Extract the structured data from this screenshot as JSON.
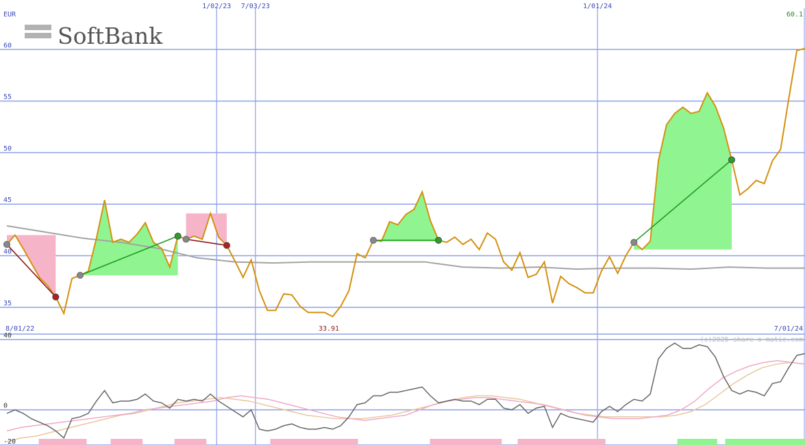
{
  "currency": "EUR",
  "last_price_label": "60.1",
  "copyright": "(c)2025 share-o-matic.com",
  "lowest_label": "33.91",
  "logo": {
    "text": "SoftBank",
    "icon": "softbank-bars-logo"
  },
  "colors": {
    "price": "#d4900f",
    "ma": "#a3a3a3",
    "grid": "#8da0e8",
    "axis_text": "#3a49b8",
    "up_fill": "#90f590",
    "down_fill": "#f5b4c8",
    "up_line": "#1f9a1f",
    "down_line": "#8b1a1a",
    "osc": "#666666",
    "osc_pink": "#f0a8c8",
    "osc_tan": "#e8c89a"
  },
  "chart_data": [
    {
      "type": "line",
      "y_unit": "EUR",
      "ylim": [
        32.4,
        64.8
      ],
      "y_ticks": [
        35,
        40,
        45,
        50,
        55,
        60
      ],
      "x_range": [
        "2022-08-01",
        "2024-07-01"
      ],
      "x_tick_labels": [
        {
          "date": "2022-08-01",
          "label": "8/01/22",
          "where": "bottom"
        },
        {
          "date": "2023-02-01",
          "label": "1/02/23",
          "where": "top"
        },
        {
          "date": "2023-03-07",
          "label": "7/03/23",
          "where": "top"
        },
        {
          "date": "2024-01-01",
          "label": "1/01/24",
          "where": "top"
        },
        {
          "date": "2024-07-01",
          "label": "7/01/24",
          "where": "bottom"
        }
      ],
      "grid": true,
      "series": [
        {
          "key": "price",
          "values": [
            41.1,
            42.0,
            40.7,
            39.3,
            37.9,
            37.1,
            36.0,
            34.4,
            37.8,
            38.1,
            38.5,
            41.7,
            45.4,
            41.3,
            41.6,
            41.3,
            42.1,
            43.2,
            41.3,
            40.7,
            38.9,
            41.9,
            41.6,
            41.9,
            41.6,
            44.1,
            41.8,
            41.0,
            39.5,
            37.9,
            39.6,
            36.6,
            34.7,
            34.7,
            36.3,
            36.2,
            35.1,
            34.5,
            34.5,
            34.5,
            34.1,
            35.1,
            36.6,
            40.2,
            39.8,
            41.5,
            41.4,
            43.3,
            43.0,
            44.0,
            44.5,
            46.2,
            43.4,
            41.5,
            41.3,
            41.8,
            41.1,
            41.6,
            40.6,
            42.2,
            41.6,
            39.4,
            38.6,
            40.3,
            37.9,
            38.2,
            39.4,
            35.4,
            38.0,
            37.3,
            36.9,
            36.4,
            36.4,
            38.5,
            39.9,
            38.3,
            40.0,
            41.3,
            40.6,
            41.4,
            49.2,
            52.7,
            53.8,
            54.4,
            53.8,
            54.0,
            55.8,
            54.5,
            52.4,
            49.3,
            45.9,
            46.5,
            47.3,
            47.0,
            49.2,
            50.3,
            55.2,
            59.9,
            60.1
          ]
        },
        {
          "key": "ma",
          "values": [
            42.9,
            42.3,
            41.7,
            41.3,
            40.7,
            39.8,
            39.4,
            39.3,
            39.4,
            39.4,
            39.4,
            39.4,
            38.9,
            38.8,
            38.9,
            38.7,
            38.8,
            38.8,
            38.7,
            38.9,
            38.8,
            38.8
          ]
        }
      ],
      "swings": [
        {
          "type": "down",
          "from_index": 0,
          "to_index": 6
        },
        {
          "type": "up",
          "from_index": 9,
          "to_index": 21
        },
        {
          "type": "down",
          "from_index": 22,
          "to_index": 27
        },
        {
          "type": "up",
          "from_index": 45,
          "to_index": 53
        },
        {
          "type": "up",
          "from_index": 77,
          "to_index": 89
        }
      ],
      "low_marker_index": 40
    },
    {
      "type": "line",
      "ylim": [
        -20,
        40
      ],
      "y_ticks": [
        -20,
        0,
        40
      ],
      "grid": true,
      "series": [
        {
          "key": "osc",
          "values": [
            -2,
            0,
            -2,
            -5,
            -7,
            -9,
            -12,
            -16,
            -5,
            -4,
            -2,
            5,
            11,
            4,
            5,
            5,
            6,
            9,
            5,
            4,
            1,
            6,
            5,
            6,
            5,
            9,
            5,
            2,
            -1,
            -4,
            0,
            -11,
            -12,
            -11,
            -9,
            -8,
            -10,
            -11,
            -11,
            -10,
            -11,
            -9,
            -4,
            3,
            4,
            8,
            8,
            10,
            10,
            11,
            12,
            13,
            8,
            4,
            5,
            6,
            5,
            5,
            3,
            6,
            6,
            1,
            0,
            3,
            -2,
            1,
            2,
            -10,
            -2,
            -4,
            -5,
            -6,
            -7,
            -1,
            2,
            -1,
            3,
            6,
            5,
            9,
            29,
            35,
            38,
            35,
            35,
            37,
            36,
            30,
            19,
            11,
            9,
            11,
            10,
            8,
            15,
            16,
            24,
            31,
            32
          ]
        },
        {
          "key": "osc_pink",
          "values": [
            -12,
            -10,
            -9,
            -8,
            -7,
            -6,
            -5,
            -4,
            -3,
            -2,
            0,
            1,
            2,
            3,
            4,
            5,
            7,
            8,
            7,
            6,
            4,
            2,
            0,
            -2,
            -4,
            -5,
            -6,
            -5,
            -4,
            -3,
            0,
            3,
            5,
            6,
            7,
            7,
            6,
            5,
            4,
            3,
            1,
            -1,
            -3,
            -4,
            -5,
            -5,
            -5,
            -4,
            -3,
            0,
            5,
            12,
            18,
            22,
            25,
            27,
            28,
            27,
            26
          ]
        },
        {
          "key": "osc_tan",
          "values": [
            -18,
            -16,
            -15,
            -13,
            -11,
            -9,
            -7,
            -5,
            -3,
            -2,
            0,
            2,
            4,
            5,
            6,
            7,
            6,
            5,
            3,
            1,
            -1,
            -3,
            -4,
            -5,
            -5,
            -5,
            -4,
            -3,
            -1,
            1,
            3,
            5,
            7,
            8,
            8,
            7,
            6,
            4,
            2,
            0,
            -2,
            -3,
            -4,
            -4,
            -4,
            -4,
            -4,
            -3,
            -1,
            3,
            9,
            15,
            20,
            24,
            26,
            27,
            26
          ]
        }
      ],
      "histogram": [
        {
          "sign": "neg",
          "start": 0.04,
          "end": 0.1
        },
        {
          "sign": "neg",
          "start": 0.13,
          "end": 0.17
        },
        {
          "sign": "neg",
          "start": 0.21,
          "end": 0.25
        },
        {
          "sign": "neg",
          "start": 0.33,
          "end": 0.44
        },
        {
          "sign": "neg",
          "start": 0.53,
          "end": 0.62
        },
        {
          "sign": "neg",
          "start": 0.64,
          "end": 0.75
        },
        {
          "sign": "pos",
          "start": 0.84,
          "end": 0.89
        },
        {
          "sign": "pos",
          "start": 0.9,
          "end": 1.0
        }
      ]
    }
  ]
}
